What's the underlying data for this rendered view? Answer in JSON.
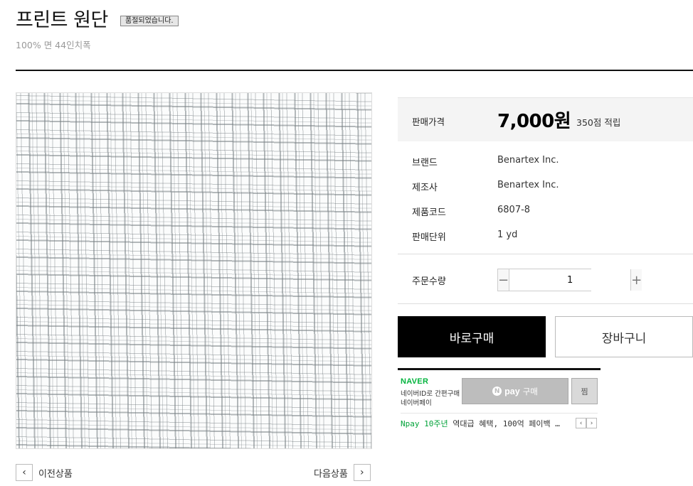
{
  "product": {
    "title": "프린트 원단",
    "soldout_badge": "품절되었습니다.",
    "subtitle": "100% 면 44인치폭"
  },
  "navigation": {
    "prev_label": "이전상품",
    "next_label": "다음상품"
  },
  "price": {
    "label": "판매가격",
    "value": "7,000원",
    "points": "350점 적립"
  },
  "info": [
    {
      "label": "브랜드",
      "value": "Benartex Inc."
    },
    {
      "label": "제조사",
      "value": "Benartex Inc."
    },
    {
      "label": "제품코드",
      "value": "6807-8"
    },
    {
      "label": "판매단위",
      "value": "1 yd"
    }
  ],
  "quantity": {
    "label": "주문수량",
    "value": "1",
    "minus": "−",
    "plus": "+"
  },
  "actions": {
    "buy_now": "바로구매",
    "cart": "장바구니"
  },
  "npay": {
    "brand": "NAVER",
    "desc_line1": "네이버ID로 간편구매",
    "desc_line2": "네이버페이",
    "pay_n": "N",
    "pay_word": "pay",
    "pay_action": "구매",
    "zzim": "찜",
    "promo_highlight": "Npay 10주년",
    "promo_text": "역대급 혜택, 100억 페이백 …",
    "promo_prev": "‹",
    "promo_next": "›"
  },
  "icons": {
    "prev": "chevron-left-icon",
    "next": "chevron-right-icon"
  },
  "colors": {
    "buy_button": "#000000",
    "naver_green": "#03b43e",
    "npay_button": "#bdbdbd"
  }
}
